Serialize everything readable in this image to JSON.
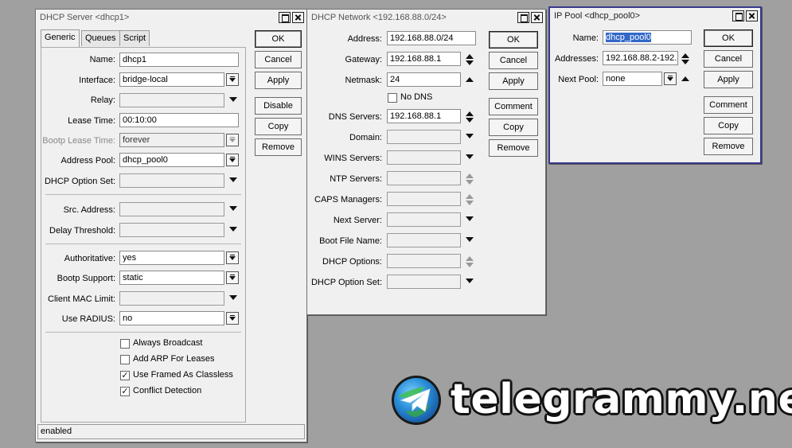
{
  "dhcp_server": {
    "title": "DHCP Server <dhcp1>",
    "tabs": [
      "Generic",
      "Queues",
      "Script"
    ],
    "fields": {
      "name": {
        "label": "Name:",
        "value": "dhcp1"
      },
      "interface": {
        "label": "Interface:",
        "value": "bridge-local"
      },
      "relay": {
        "label": "Relay:",
        "value": ""
      },
      "lease_time": {
        "label": "Lease Time:",
        "value": "00:10:00"
      },
      "bootp_lease_time": {
        "label": "Bootp Lease Time:",
        "value": "forever"
      },
      "address_pool": {
        "label": "Address Pool:",
        "value": "dhcp_pool0"
      },
      "dhcp_option_set": {
        "label": "DHCP Option Set:",
        "value": ""
      },
      "src_address": {
        "label": "Src. Address:",
        "value": ""
      },
      "delay_threshold": {
        "label": "Delay Threshold:",
        "value": ""
      },
      "authoritative": {
        "label": "Authoritative:",
        "value": "yes"
      },
      "bootp_support": {
        "label": "Bootp Support:",
        "value": "static"
      },
      "client_mac_limit": {
        "label": "Client MAC Limit:",
        "value": ""
      },
      "use_radius": {
        "label": "Use RADIUS:",
        "value": "no"
      }
    },
    "checkboxes": {
      "always_broadcast": {
        "label": "Always Broadcast",
        "checked": false
      },
      "add_arp": {
        "label": "Add ARP For Leases",
        "checked": false
      },
      "use_framed": {
        "label": "Use Framed As Classless",
        "checked": true
      },
      "conflict_detection": {
        "label": "Conflict Detection",
        "checked": true
      }
    },
    "buttons": {
      "ok": "OK",
      "cancel": "Cancel",
      "apply": "Apply",
      "disable": "Disable",
      "copy": "Copy",
      "remove": "Remove"
    },
    "status": "enabled"
  },
  "dhcp_network": {
    "title": "DHCP Network <192.168.88.0/24>",
    "fields": {
      "address": {
        "label": "Address:",
        "value": "192.168.88.0/24"
      },
      "gateway": {
        "label": "Gateway:",
        "value": "192.168.88.1"
      },
      "netmask": {
        "label": "Netmask:",
        "value": "24"
      },
      "no_dns": {
        "label": "No DNS",
        "checked": false
      },
      "dns_servers": {
        "label": "DNS Servers:",
        "value": "192.168.88.1"
      },
      "domain": {
        "label": "Domain:",
        "value": ""
      },
      "wins_servers": {
        "label": "WINS Servers:",
        "value": ""
      },
      "ntp_servers": {
        "label": "NTP Servers:",
        "value": ""
      },
      "caps_managers": {
        "label": "CAPS Managers:",
        "value": ""
      },
      "next_server": {
        "label": "Next Server:",
        "value": ""
      },
      "boot_file_name": {
        "label": "Boot File Name:",
        "value": ""
      },
      "dhcp_options": {
        "label": "DHCP Options:",
        "value": ""
      },
      "dhcp_option_set": {
        "label": "DHCP Option Set:",
        "value": ""
      }
    },
    "buttons": {
      "ok": "OK",
      "cancel": "Cancel",
      "apply": "Apply",
      "comment": "Comment",
      "copy": "Copy",
      "remove": "Remove"
    }
  },
  "ip_pool": {
    "title": "IP Pool <dhcp_pool0>",
    "fields": {
      "name": {
        "label": "Name:",
        "value": "dhcp_pool0"
      },
      "addresses": {
        "label": "Addresses:",
        "value": "192.168.88.2-192."
      },
      "next_pool": {
        "label": "Next Pool:",
        "value": "none"
      }
    },
    "buttons": {
      "ok": "OK",
      "cancel": "Cancel",
      "apply": "Apply",
      "comment": "Comment",
      "copy": "Copy",
      "remove": "Remove"
    }
  },
  "watermark": {
    "text": "telegrammy.net"
  },
  "colors": {
    "desktop": "#a0a0a0",
    "window": "#f0f0f0",
    "active_border": "#3a3a8c",
    "selection": "#3268c8"
  }
}
